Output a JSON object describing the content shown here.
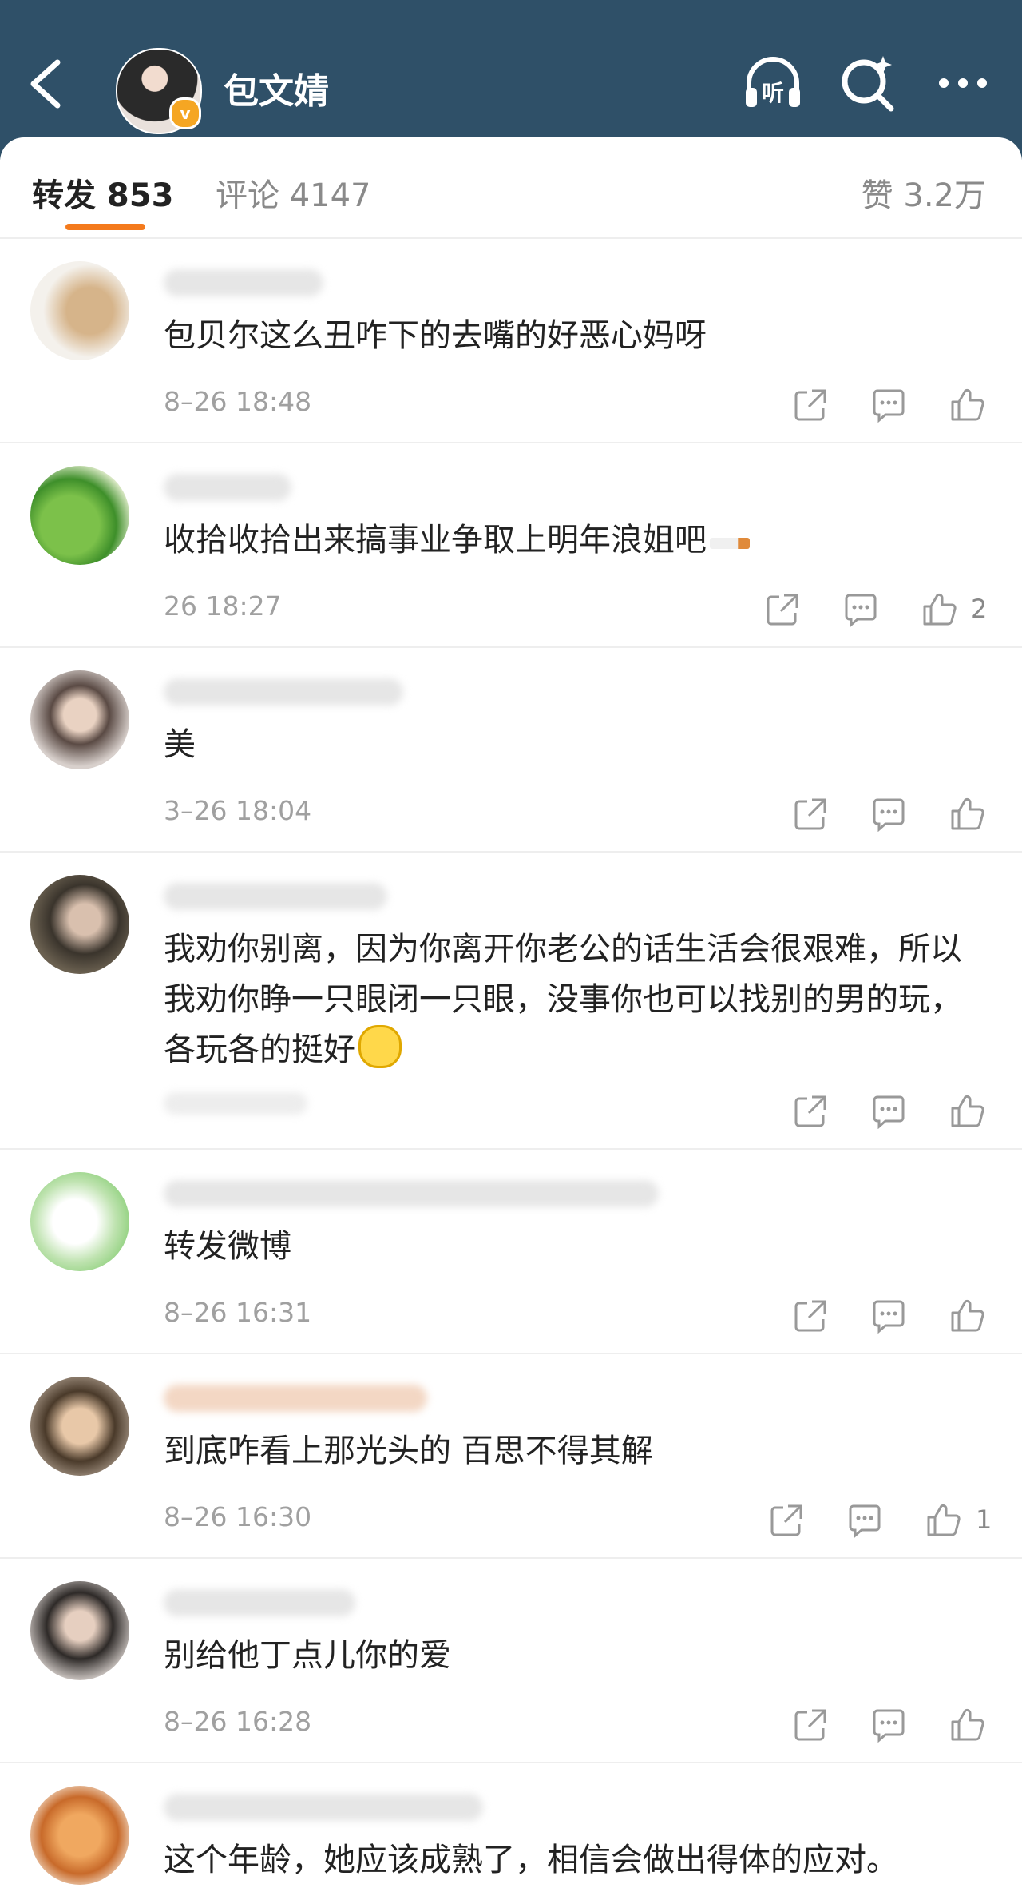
{
  "header": {
    "title": "包文婧",
    "listen_label": "听"
  },
  "tabs": {
    "reposts": "转发 853",
    "comments": "评论 4147",
    "likes": "赞 3.2万"
  },
  "comments": [
    {
      "text": "包贝尔这么丑咋下的去嘴的好恶心妈呀",
      "time": "8–26 18:48",
      "likes": ""
    },
    {
      "text": "收拾收拾出来搞事业争取上明年浪姐吧",
      "time": "26 18:27",
      "likes": "2"
    },
    {
      "text": "美",
      "time": "3–26 18:04",
      "likes": ""
    },
    {
      "text": "我劝你别离，因为你离开你老公的话生活会很艰难，所以我劝你睁一只眼闭一只眼，没事你也可以找别的男的玩，各玩各的挺好",
      "time": "",
      "likes": ""
    },
    {
      "text": "转发微博",
      "time": "8–26 16:31",
      "likes": ""
    },
    {
      "text": "到底咋看上那光头的 百思不得其解",
      "time": "8–26 16:30",
      "likes": "1"
    },
    {
      "text": "别给他丁点儿你的爱",
      "time": "8–26 16:28",
      "likes": ""
    },
    {
      "text": "这个年龄，她应该成熟了，相信会做出得体的应对。",
      "time": "",
      "likes": ""
    }
  ],
  "colors": {
    "header_bg": "#2f5068",
    "accent": "#f47a1d",
    "badge": "#f5a623"
  }
}
